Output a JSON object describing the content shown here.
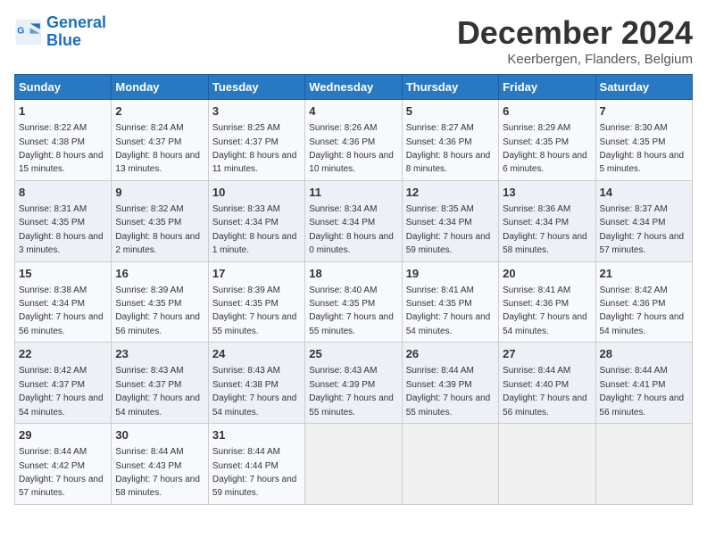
{
  "logo": {
    "line1": "General",
    "line2": "Blue"
  },
  "title": "December 2024",
  "subtitle": "Keerbergen, Flanders, Belgium",
  "weekdays": [
    "Sunday",
    "Monday",
    "Tuesday",
    "Wednesday",
    "Thursday",
    "Friday",
    "Saturday"
  ],
  "weeks": [
    [
      {
        "day": "1",
        "sunrise": "Sunrise: 8:22 AM",
        "sunset": "Sunset: 4:38 PM",
        "daylight": "Daylight: 8 hours and 15 minutes."
      },
      {
        "day": "2",
        "sunrise": "Sunrise: 8:24 AM",
        "sunset": "Sunset: 4:37 PM",
        "daylight": "Daylight: 8 hours and 13 minutes."
      },
      {
        "day": "3",
        "sunrise": "Sunrise: 8:25 AM",
        "sunset": "Sunset: 4:37 PM",
        "daylight": "Daylight: 8 hours and 11 minutes."
      },
      {
        "day": "4",
        "sunrise": "Sunrise: 8:26 AM",
        "sunset": "Sunset: 4:36 PM",
        "daylight": "Daylight: 8 hours and 10 minutes."
      },
      {
        "day": "5",
        "sunrise": "Sunrise: 8:27 AM",
        "sunset": "Sunset: 4:36 PM",
        "daylight": "Daylight: 8 hours and 8 minutes."
      },
      {
        "day": "6",
        "sunrise": "Sunrise: 8:29 AM",
        "sunset": "Sunset: 4:35 PM",
        "daylight": "Daylight: 8 hours and 6 minutes."
      },
      {
        "day": "7",
        "sunrise": "Sunrise: 8:30 AM",
        "sunset": "Sunset: 4:35 PM",
        "daylight": "Daylight: 8 hours and 5 minutes."
      }
    ],
    [
      {
        "day": "8",
        "sunrise": "Sunrise: 8:31 AM",
        "sunset": "Sunset: 4:35 PM",
        "daylight": "Daylight: 8 hours and 3 minutes."
      },
      {
        "day": "9",
        "sunrise": "Sunrise: 8:32 AM",
        "sunset": "Sunset: 4:35 PM",
        "daylight": "Daylight: 8 hours and 2 minutes."
      },
      {
        "day": "10",
        "sunrise": "Sunrise: 8:33 AM",
        "sunset": "Sunset: 4:34 PM",
        "daylight": "Daylight: 8 hours and 1 minute."
      },
      {
        "day": "11",
        "sunrise": "Sunrise: 8:34 AM",
        "sunset": "Sunset: 4:34 PM",
        "daylight": "Daylight: 8 hours and 0 minutes."
      },
      {
        "day": "12",
        "sunrise": "Sunrise: 8:35 AM",
        "sunset": "Sunset: 4:34 PM",
        "daylight": "Daylight: 7 hours and 59 minutes."
      },
      {
        "day": "13",
        "sunrise": "Sunrise: 8:36 AM",
        "sunset": "Sunset: 4:34 PM",
        "daylight": "Daylight: 7 hours and 58 minutes."
      },
      {
        "day": "14",
        "sunrise": "Sunrise: 8:37 AM",
        "sunset": "Sunset: 4:34 PM",
        "daylight": "Daylight: 7 hours and 57 minutes."
      }
    ],
    [
      {
        "day": "15",
        "sunrise": "Sunrise: 8:38 AM",
        "sunset": "Sunset: 4:34 PM",
        "daylight": "Daylight: 7 hours and 56 minutes."
      },
      {
        "day": "16",
        "sunrise": "Sunrise: 8:39 AM",
        "sunset": "Sunset: 4:35 PM",
        "daylight": "Daylight: 7 hours and 56 minutes."
      },
      {
        "day": "17",
        "sunrise": "Sunrise: 8:39 AM",
        "sunset": "Sunset: 4:35 PM",
        "daylight": "Daylight: 7 hours and 55 minutes."
      },
      {
        "day": "18",
        "sunrise": "Sunrise: 8:40 AM",
        "sunset": "Sunset: 4:35 PM",
        "daylight": "Daylight: 7 hours and 55 minutes."
      },
      {
        "day": "19",
        "sunrise": "Sunrise: 8:41 AM",
        "sunset": "Sunset: 4:35 PM",
        "daylight": "Daylight: 7 hours and 54 minutes."
      },
      {
        "day": "20",
        "sunrise": "Sunrise: 8:41 AM",
        "sunset": "Sunset: 4:36 PM",
        "daylight": "Daylight: 7 hours and 54 minutes."
      },
      {
        "day": "21",
        "sunrise": "Sunrise: 8:42 AM",
        "sunset": "Sunset: 4:36 PM",
        "daylight": "Daylight: 7 hours and 54 minutes."
      }
    ],
    [
      {
        "day": "22",
        "sunrise": "Sunrise: 8:42 AM",
        "sunset": "Sunset: 4:37 PM",
        "daylight": "Daylight: 7 hours and 54 minutes."
      },
      {
        "day": "23",
        "sunrise": "Sunrise: 8:43 AM",
        "sunset": "Sunset: 4:37 PM",
        "daylight": "Daylight: 7 hours and 54 minutes."
      },
      {
        "day": "24",
        "sunrise": "Sunrise: 8:43 AM",
        "sunset": "Sunset: 4:38 PM",
        "daylight": "Daylight: 7 hours and 54 minutes."
      },
      {
        "day": "25",
        "sunrise": "Sunrise: 8:43 AM",
        "sunset": "Sunset: 4:39 PM",
        "daylight": "Daylight: 7 hours and 55 minutes."
      },
      {
        "day": "26",
        "sunrise": "Sunrise: 8:44 AM",
        "sunset": "Sunset: 4:39 PM",
        "daylight": "Daylight: 7 hours and 55 minutes."
      },
      {
        "day": "27",
        "sunrise": "Sunrise: 8:44 AM",
        "sunset": "Sunset: 4:40 PM",
        "daylight": "Daylight: 7 hours and 56 minutes."
      },
      {
        "day": "28",
        "sunrise": "Sunrise: 8:44 AM",
        "sunset": "Sunset: 4:41 PM",
        "daylight": "Daylight: 7 hours and 56 minutes."
      }
    ],
    [
      {
        "day": "29",
        "sunrise": "Sunrise: 8:44 AM",
        "sunset": "Sunset: 4:42 PM",
        "daylight": "Daylight: 7 hours and 57 minutes."
      },
      {
        "day": "30",
        "sunrise": "Sunrise: 8:44 AM",
        "sunset": "Sunset: 4:43 PM",
        "daylight": "Daylight: 7 hours and 58 minutes."
      },
      {
        "day": "31",
        "sunrise": "Sunrise: 8:44 AM",
        "sunset": "Sunset: 4:44 PM",
        "daylight": "Daylight: 7 hours and 59 minutes."
      },
      null,
      null,
      null,
      null
    ]
  ]
}
